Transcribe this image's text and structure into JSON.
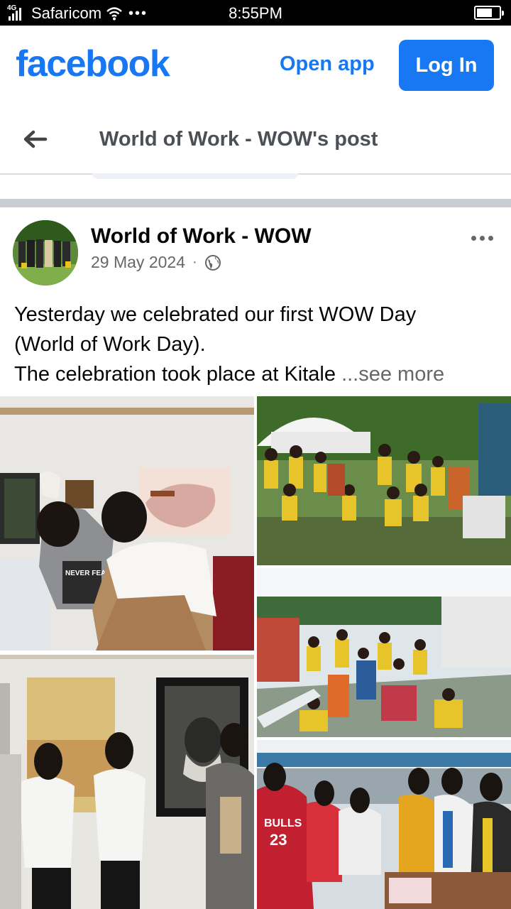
{
  "status_bar": {
    "network": "4G",
    "carrier": "Safaricom",
    "time": "8:55PM",
    "battery_level": 0.7
  },
  "header": {
    "logo": "facebook",
    "open_app": "Open app",
    "log_in": "Log In"
  },
  "nav": {
    "title": "World of Work - WOW's post"
  },
  "post": {
    "author": "World of Work - WOW",
    "date": "29 May 2024",
    "separator": "·",
    "text_lines": [
      "Yesterday we celebrated our first WOW Day",
      "(World of Work Day).",
      "The celebration took place at Kitale"
    ],
    "see_more": "...see more",
    "photo_texts": {
      "shirt_text": "NEVER FEAR",
      "jersey_text": "BULLS",
      "jersey_number": "23"
    }
  },
  "colors": {
    "brand": "#1877f2",
    "text_secondary": "#65676b",
    "title_gray": "#4b4f56"
  },
  "icons": [
    "back-arrow-icon",
    "globe-icon",
    "more-options-icon",
    "wifi-icon",
    "signal-icon",
    "battery-icon"
  ]
}
